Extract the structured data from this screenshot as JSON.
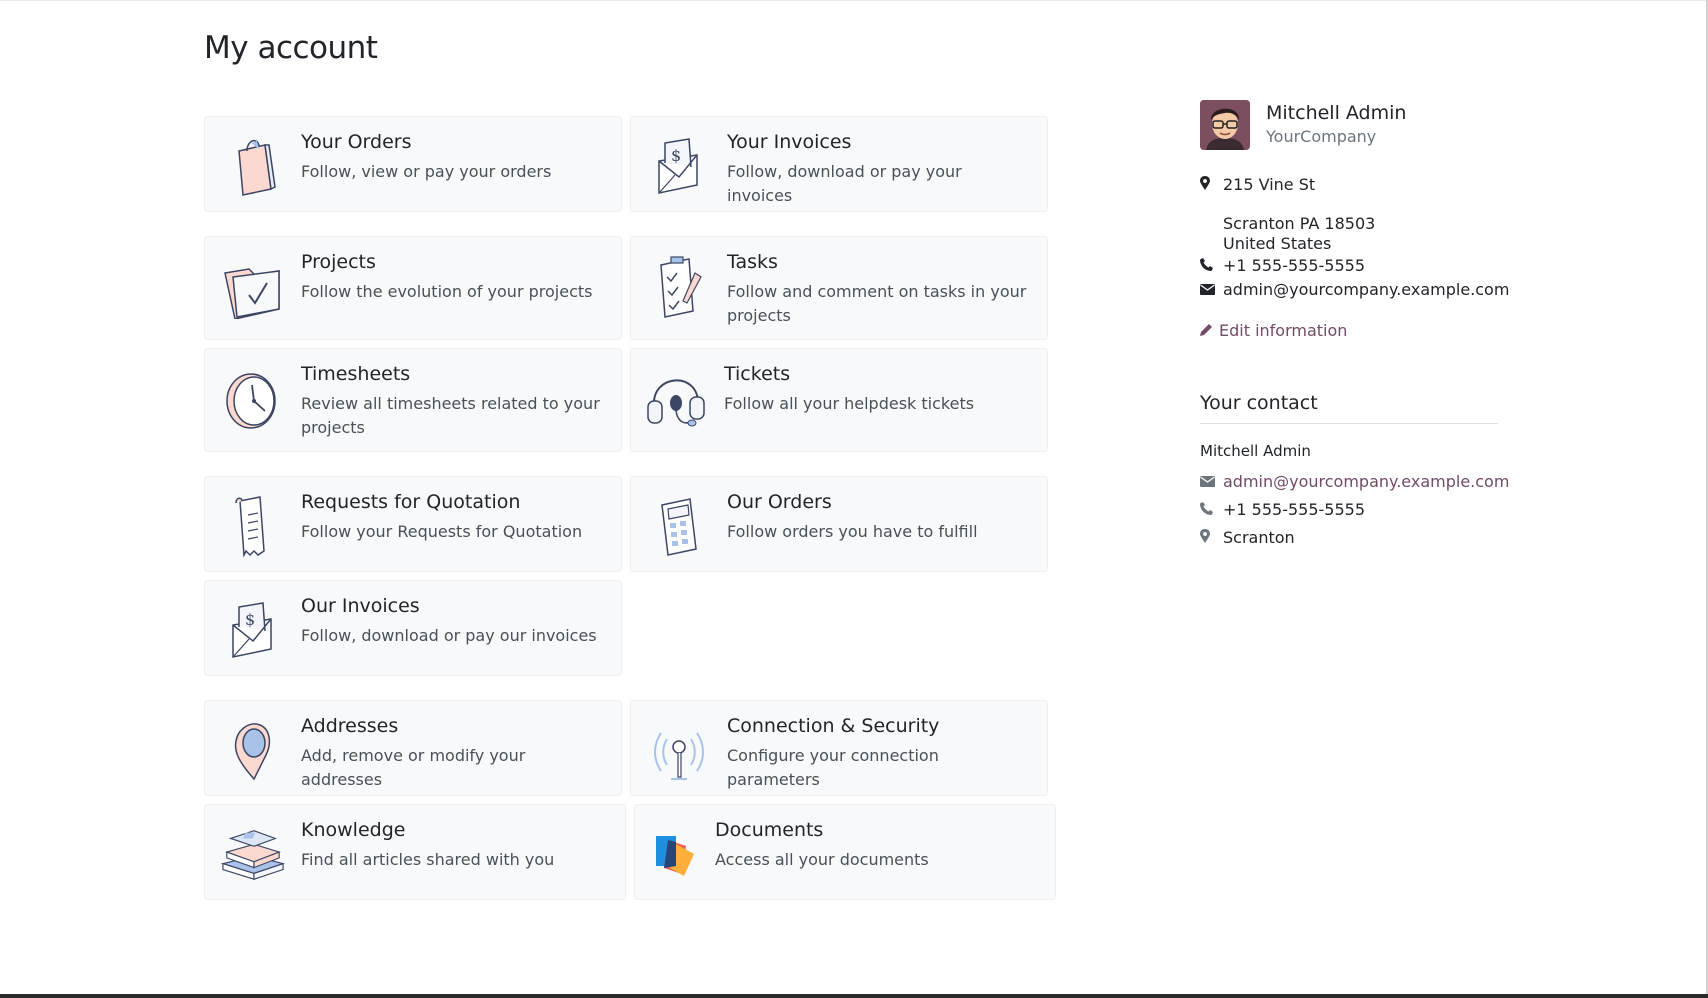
{
  "page": {
    "title": "My account"
  },
  "cards": [
    {
      "title": "Your Orders",
      "desc": "Follow, view or pay your orders"
    },
    {
      "title": "Your Invoices",
      "desc": "Follow, download or pay your invoices"
    },
    {
      "title": "Projects",
      "desc": "Follow the evolution of your projects"
    },
    {
      "title": "Tasks",
      "desc": "Follow and comment on tasks in your projects"
    },
    {
      "title": "Timesheets",
      "desc": "Review all timesheets related to your projects"
    },
    {
      "title": "Tickets",
      "desc": "Follow all your helpdesk tickets"
    },
    {
      "title": "Requests for Quotation",
      "desc": "Follow your Requests for Quotation"
    },
    {
      "title": "Our Orders",
      "desc": "Follow orders you have to fulfill"
    },
    {
      "title": "Our Invoices",
      "desc": "Follow, download or pay our invoices"
    },
    {
      "title": "Addresses",
      "desc": "Add, remove or modify your addresses"
    },
    {
      "title": "Connection & Security",
      "desc": "Configure your connection parameters"
    },
    {
      "title": "Knowledge",
      "desc": "Find all articles shared with you"
    },
    {
      "title": "Documents",
      "desc": "Access all your documents"
    }
  ],
  "profile": {
    "name": "Mitchell Admin",
    "company": "YourCompany",
    "street": "215 Vine St",
    "city_line": "Scranton PA 18503",
    "country": "United States",
    "phone": "+1 555-555-5555",
    "email": "admin@yourcompany.example.com",
    "edit_label": "Edit information"
  },
  "contact": {
    "title": "Your contact",
    "name": "Mitchell Admin",
    "email": "admin@yourcompany.example.com",
    "phone": "+1 555-555-5555",
    "city": "Scranton"
  },
  "colors": {
    "accent": "#714b67",
    "card_bg": "#f8f9fa",
    "text": "#212529",
    "muted": "#6c757d"
  }
}
